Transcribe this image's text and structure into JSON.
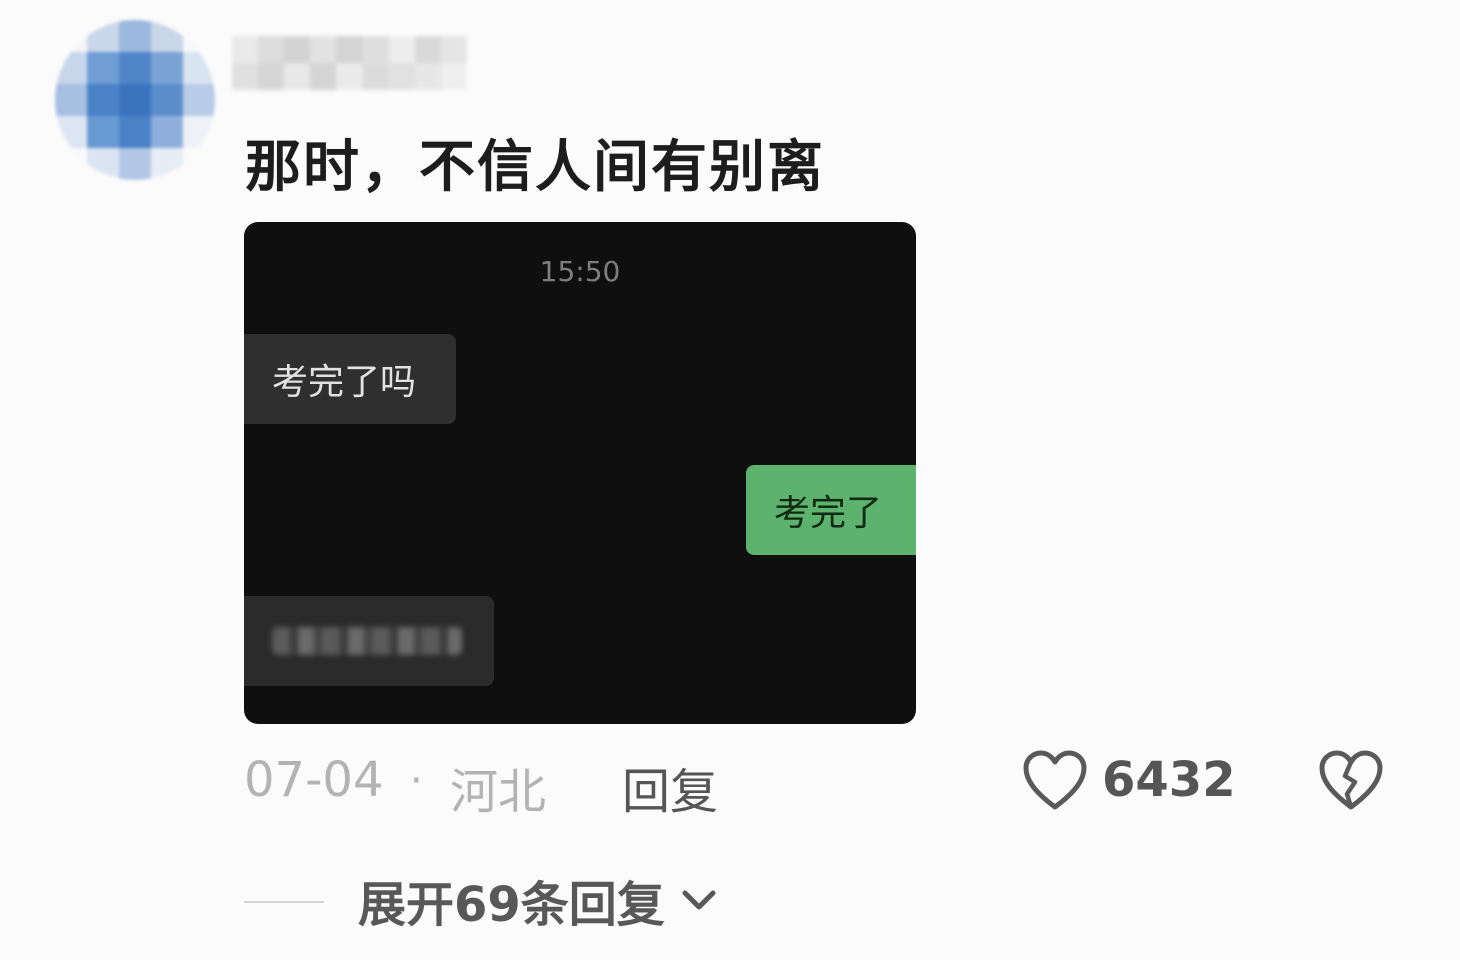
{
  "comment": {
    "author_avatar_icon": "avatar-pixelated",
    "author_name_redacted": true,
    "text": "那时，不信人间有别离",
    "image": {
      "time": "15:50",
      "messages": [
        {
          "side": "left",
          "text": "考完了吗"
        },
        {
          "side": "right",
          "text": "考完了"
        },
        {
          "side": "left",
          "text": "",
          "redacted": true
        }
      ],
      "colors": {
        "background": "#0f0f0f",
        "incoming_bubble": "#2f2f2f",
        "outgoing_bubble": "#5db36d"
      }
    },
    "meta": {
      "date": "07-04",
      "separator": "·",
      "location": "河北",
      "reply_label": "回复"
    },
    "likes": {
      "icon": "heart-outline-icon",
      "count": "6432"
    },
    "dislike": {
      "icon": "broken-heart-icon"
    },
    "expand": {
      "label": "展开69条回复",
      "icon": "chevron-down-icon"
    }
  }
}
